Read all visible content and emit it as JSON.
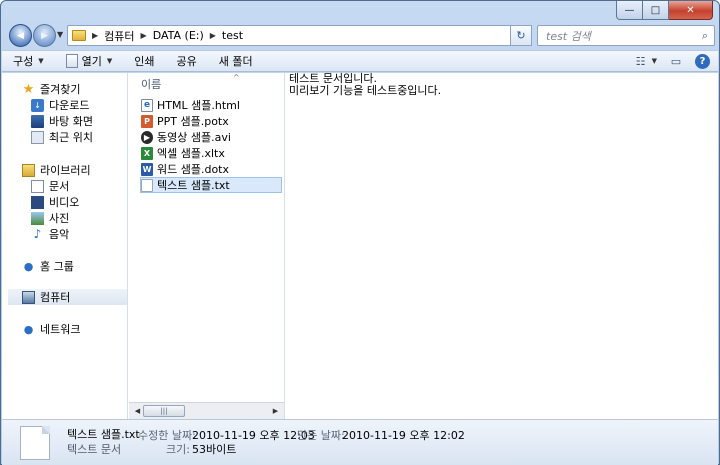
{
  "window": {
    "minimize": "—",
    "maximize": "□",
    "close": "✕"
  },
  "nav": {
    "back": "◀",
    "forward": "▶",
    "dropdown": "▼"
  },
  "address": {
    "crumbs": [
      "컴퓨터",
      "DATA (E:)",
      "test"
    ],
    "separator": "▶",
    "dropdown": "▼"
  },
  "refresh": "↻",
  "search": {
    "placeholder": "test 검색",
    "icon": "search-icon",
    "glyph": "⌕"
  },
  "toolbar": {
    "organize": "구성",
    "open": "열기",
    "print": "인쇄",
    "share": "공유",
    "new_folder": "새 폴더",
    "arrow": "▼",
    "view_glyph": "☷",
    "pane_glyph": "▭",
    "help": "?"
  },
  "sidebar": {
    "favorites": {
      "label": "즐겨찾기",
      "items": [
        {
          "label": "다운로드",
          "icon": "download-icon"
        },
        {
          "label": "바탕 화면",
          "icon": "desktop-icon"
        },
        {
          "label": "최근 위치",
          "icon": "recent-places-icon"
        }
      ]
    },
    "libraries": {
      "label": "라이브러리",
      "items": [
        {
          "label": "문서",
          "icon": "documents-icon"
        },
        {
          "label": "비디오",
          "icon": "videos-icon"
        },
        {
          "label": "사진",
          "icon": "pictures-icon"
        },
        {
          "label": "음악",
          "icon": "music-icon"
        }
      ]
    },
    "homegroup": "홈 그룹",
    "computer": "컴퓨터",
    "network": "네트워크"
  },
  "file_list": {
    "column_header": "이름",
    "sort_glyph": "^",
    "files": [
      {
        "name": "HTML 샘플.html",
        "icon": "html-file-icon"
      },
      {
        "name": "PPT 샘플.potx",
        "icon": "powerpoint-file-icon"
      },
      {
        "name": "동영상 샘플.avi",
        "icon": "video-file-icon"
      },
      {
        "name": "엑셀 샘플.xltx",
        "icon": "excel-file-icon"
      },
      {
        "name": "워드 샘플.dotx",
        "icon": "word-file-icon"
      },
      {
        "name": "텍스트 샘플.txt",
        "icon": "text-file-icon"
      }
    ],
    "selected_index": 5,
    "scroll_left": "◀",
    "scroll_right": "▶",
    "scroll_grip": "|||"
  },
  "preview": {
    "lines": [
      "테스트 문서입니다.",
      "미리보기 기능을 테스트중입니다."
    ]
  },
  "details": {
    "file_name": "텍스트 샘플.txt",
    "file_type": "텍스트 문서",
    "modified_label": "수정한 날짜:",
    "modified_value": "2010-11-19 오후 12:03",
    "created_label": "만든 날짜:",
    "created_value": "2010-11-19 오후 12:02",
    "size_label": "크기:",
    "size_value": "53바이트"
  }
}
